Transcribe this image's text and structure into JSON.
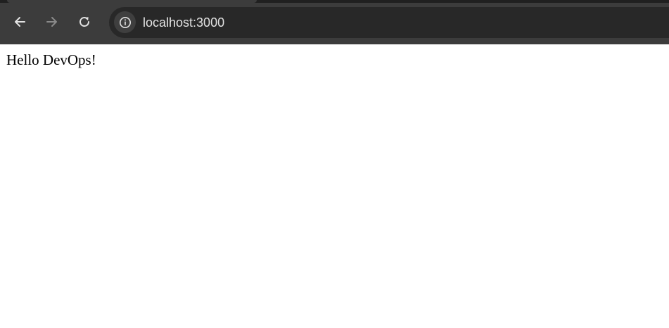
{
  "browser": {
    "url": "localhost:3000",
    "icons": {
      "back": "arrow-left-icon",
      "forward": "arrow-right-icon",
      "reload": "reload-icon",
      "site_info": "info-icon"
    },
    "colors": {
      "toolbar": "#3c3c3c",
      "address_bar": "#282828",
      "icon_active": "#e3e3e3",
      "icon_disabled": "#8a8a8a"
    }
  },
  "page": {
    "text": "Hello DevOps!"
  }
}
